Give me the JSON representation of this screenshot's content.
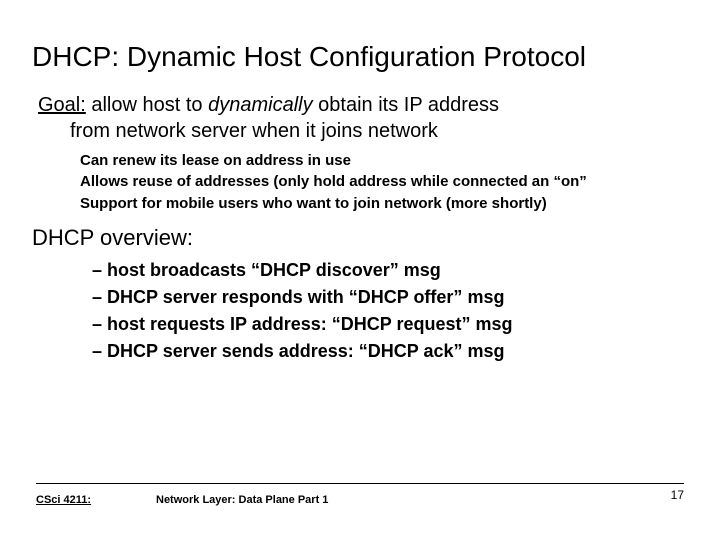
{
  "title": "DHCP: Dynamic Host Configuration Protocol",
  "goal": {
    "label": "Goal:",
    "line1a": " allow host to ",
    "dynamic": "dynamically",
    "line1b": " obtain its IP address",
    "line2": "from network server when it joins network",
    "bullets": [
      "Can renew its lease on address in use",
      "Allows reuse of addresses (only hold address while connected an “on”",
      "Support for mobile users who want to join network (more shortly)"
    ]
  },
  "overview": {
    "heading": "DHCP overview:",
    "steps": [
      "host broadcasts “DHCP discover” msg",
      "DHCP server responds with “DHCP offer” msg",
      "host requests IP address: “DHCP request” msg",
      "DHCP server sends address: “DHCP ack” msg"
    ]
  },
  "footer": {
    "course": "CSci 4211:",
    "center": "Network Layer: Data Plane Part 1",
    "page": "17"
  }
}
